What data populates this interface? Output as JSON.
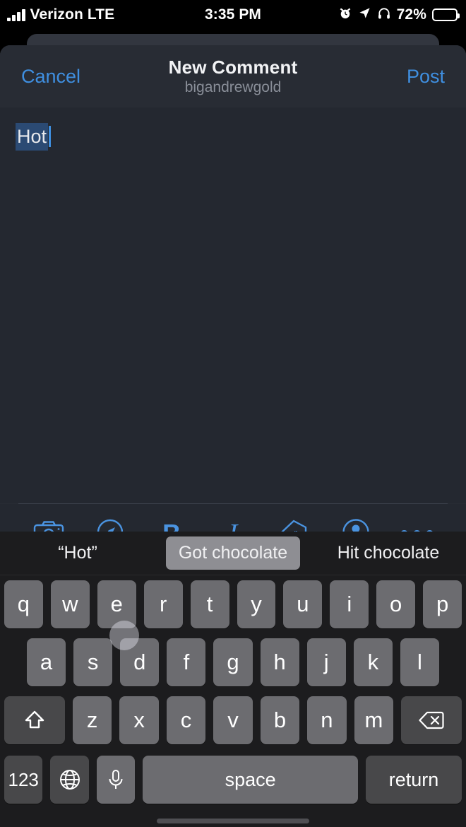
{
  "status_bar": {
    "carrier": "Verizon LTE",
    "time": "3:35 PM",
    "battery_percent": "72%",
    "icons": [
      "alarm-icon",
      "location-arrow-icon",
      "headphones-icon",
      "battery-icon"
    ],
    "battery_level": 72
  },
  "nav": {
    "cancel_label": "Cancel",
    "title": "New Comment",
    "subtitle": "bigandrewgold",
    "post_label": "Post",
    "accent_color": "#3f8fe0"
  },
  "editor": {
    "text": "Hot",
    "selection_color": "#2b4a73",
    "caret_color": "#3f8fe0",
    "background": "#242830"
  },
  "format_toolbar": {
    "accent_color": "#4a93e0",
    "items": [
      {
        "name": "camera-icon",
        "label": ""
      },
      {
        "name": "compass-icon",
        "label": ""
      },
      {
        "name": "bold-icon",
        "label": "B"
      },
      {
        "name": "italic-icon",
        "label": "I"
      },
      {
        "name": "subreddit-tag-icon",
        "label": "r"
      },
      {
        "name": "user-icon",
        "label": ""
      },
      {
        "name": "more-icon",
        "label": ""
      }
    ]
  },
  "keyboard": {
    "predictions": [
      {
        "label": "“Hot”",
        "selected": false
      },
      {
        "label": "Got chocolate",
        "selected": true
      },
      {
        "label": "Hit chocolate",
        "selected": false
      }
    ],
    "row1": [
      "q",
      "w",
      "e",
      "r",
      "t",
      "y",
      "u",
      "i",
      "o",
      "p"
    ],
    "row2": [
      "a",
      "s",
      "d",
      "f",
      "g",
      "h",
      "j",
      "k",
      "l"
    ],
    "row3": [
      "z",
      "x",
      "c",
      "v",
      "b",
      "n",
      "m"
    ],
    "shift_label": "",
    "delete_label": "",
    "numeric_label": "123",
    "globe_label": "",
    "mic_label": "",
    "space_label": "space",
    "return_label": "return",
    "key_color": "#6c6c70",
    "special_key_color": "#48484a",
    "background": "#1c1c1e"
  }
}
